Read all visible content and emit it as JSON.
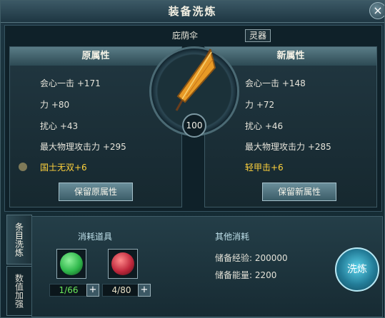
{
  "window": {
    "title": "装备洗炼",
    "close_icon": "close-icon"
  },
  "item": {
    "name": "庇荫伞",
    "tag": "灵器",
    "level": "100"
  },
  "left_panel": {
    "heading": "原属性",
    "attrs": [
      {
        "text": "会心一击 +171"
      },
      {
        "text": "力 +80"
      },
      {
        "text": "扰心 +43"
      },
      {
        "text": "最大物理攻击力 +295"
      }
    ],
    "special": "国士无双+6",
    "button": "保留原属性"
  },
  "right_panel": {
    "heading": "新属性",
    "attrs": [
      {
        "text": "会心一击 +148"
      },
      {
        "text": "力 +72"
      },
      {
        "text": "扰心 +46"
      },
      {
        "text": "最大物理攻击力 +285"
      }
    ],
    "special": "轻甲击+6",
    "button": "保留新属性"
  },
  "tabs": [
    {
      "label": "条目洗炼"
    },
    {
      "label": "数值加强"
    }
  ],
  "consume": {
    "heading": "消耗道具",
    "items": [
      {
        "count": "1/66",
        "color": "#2fb84b"
      },
      {
        "count": "4/80",
        "color": "#c0283c"
      }
    ],
    "plus": "+"
  },
  "other": {
    "heading": "其他消耗",
    "exp": "储备经验: 200000",
    "energy": "储备能量: 2200"
  },
  "action": {
    "refine": "洗炼"
  },
  "colors": {
    "gold": "#ffd23c",
    "green": "#6ae85a"
  }
}
